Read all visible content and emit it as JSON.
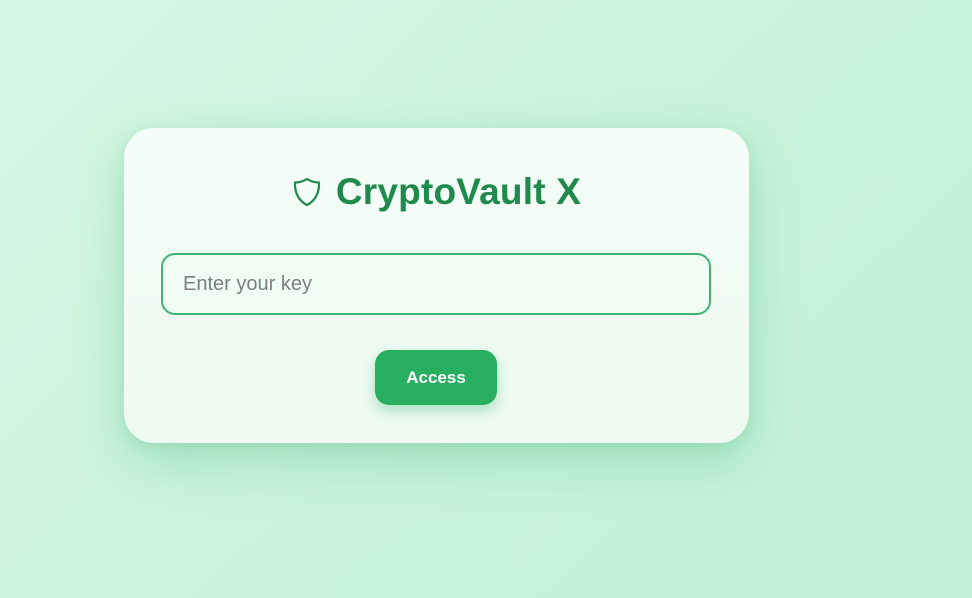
{
  "app": {
    "title": "CryptoVault X",
    "icon": "shield-icon"
  },
  "login": {
    "key_placeholder": "Enter your key",
    "key_value": "",
    "access_label": "Access"
  },
  "colors": {
    "accent": "#27ae60",
    "title": "#1e8a4c",
    "input_border": "#3cb46e",
    "background": "#c9f3dc",
    "card": "#f3fcf6"
  }
}
